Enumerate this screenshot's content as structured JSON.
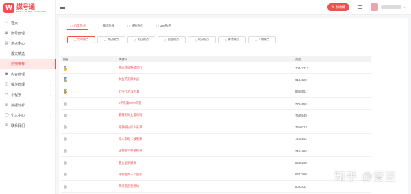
{
  "app": {
    "logo_glyph": "W",
    "title": "媒号通",
    "subtitle": "MEDIA  TRADE  PLATFORM"
  },
  "header": {
    "favorite_label": "加收藏",
    "favorite_glyph": "✎"
  },
  "sidebar": {
    "items": [
      {
        "icon": "⌂",
        "label": "首页"
      },
      {
        "icon": "▦",
        "label": "账号管理",
        "caret": "⌄"
      },
      {
        "icon": "▤",
        "label": "热点中心",
        "caret": "⌃"
      },
      {
        "label": "爆文精选",
        "sub": true
      },
      {
        "label": "热榜推荐",
        "sub": true,
        "active": true
      },
      {
        "icon": "▣",
        "label": "内容管理",
        "caret": "⌄"
      },
      {
        "icon": "◫",
        "label": "操作管理",
        "caret": "⌄"
      },
      {
        "icon": "□",
        "label": "小程序",
        "caret": "⌄"
      },
      {
        "icon": "▥",
        "label": "数据分析",
        "caret": "⌄"
      },
      {
        "icon": "◯",
        "label": "个人中心",
        "caret": "⌄"
      },
      {
        "icon": "✆",
        "label": "联系我们"
      }
    ]
  },
  "main": {
    "tabs": [
      {
        "icon": "◻",
        "label": "百度热点",
        "active": true
      },
      {
        "icon": "◻",
        "label": "微博热搜"
      },
      {
        "icon": "◻",
        "label": "搜狗热点"
      },
      {
        "icon": "◻",
        "label": "360热点"
      }
    ],
    "subtabs": [
      {
        "icon": "◇",
        "label": "实时热点",
        "active": true
      },
      {
        "icon": "◇",
        "label": "今日热点"
      },
      {
        "icon": "◇",
        "label": "七日热点"
      },
      {
        "icon": "◇",
        "label": "民生热点"
      },
      {
        "icon": "◇",
        "label": "娱乐热点"
      },
      {
        "icon": "◇",
        "label": "体育热点"
      },
      {
        "icon": "◇",
        "label": "人物热点"
      }
    ],
    "table": {
      "headers": {
        "rank": "排名",
        "keyword": "关键词",
        "heat": "热度"
      },
      "rows": [
        {
          "medal": "gold",
          "keyword": "两成党旗杆疑出行",
          "heat": "10842712",
          "trend": "up"
        },
        {
          "medal": "silver",
          "keyword": "女生节美颜大战",
          "heat": "9134022",
          "trend": "up"
        },
        {
          "medal": "bronze",
          "keyword": "87岁小老发写真",
          "heat": "8856551",
          "trend": "up"
        },
        {
          "keyword": "5年高速3000元罚",
          "heat": "7784059",
          "trend": "down"
        },
        {
          "keyword": "最精彩的女篮鸡吗",
          "heat": "7535549",
          "trend": "down"
        },
        {
          "keyword": "赔钟被执行人名单",
          "heat": "7456013",
          "trend": "down"
        },
        {
          "keyword": "无人车刷卡被撤掉",
          "heat": "7216142",
          "trend": "up"
        },
        {
          "keyword": "王德最早打破纪录",
          "heat": "7124722",
          "trend": "down"
        },
        {
          "keyword": "曹女星驿被拼",
          "heat": "6456140",
          "trend": "up"
        },
        {
          "keyword": "孙杨世界三个国家",
          "heat": "6447760",
          "trend": "up"
        },
        {
          "keyword": "养老金是要继续",
          "heat": "6092531",
          "trend": "up"
        }
      ]
    }
  },
  "watermark": "知乎 @爱豆",
  "colors": {
    "brand": "#f0504e",
    "down": "#5470c6",
    "gold": "#e8b830",
    "silver": "#a7b38c",
    "bronze": "#c99a4a"
  }
}
